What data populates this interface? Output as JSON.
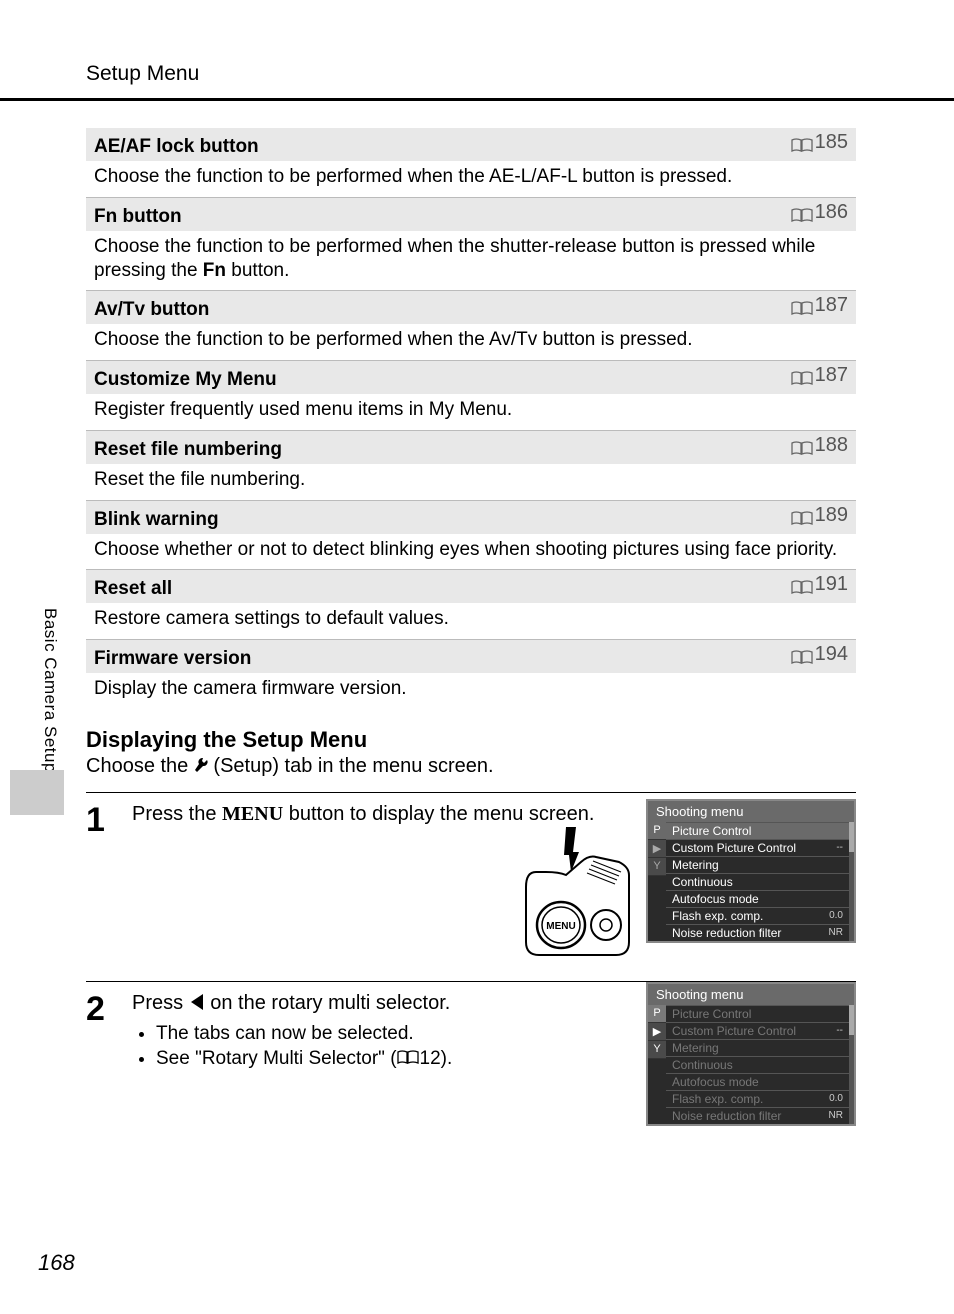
{
  "page": {
    "title": "Setup Menu",
    "sidebar_label": "Basic Camera Setup",
    "number": "168"
  },
  "items": [
    {
      "title": "AE/AF lock button",
      "page": "185",
      "desc": "Choose the function to be performed when the AE-L/AF-L button is pressed."
    },
    {
      "title": "Fn button",
      "page": "186",
      "desc_pre": "Choose the function to be performed when the shutter-release button is pressed while pressing the ",
      "desc_fn": "Fn",
      "desc_post": " button."
    },
    {
      "title": "Av/Tv button",
      "page": "187",
      "desc": "Choose the function to be performed when the Av/Tv button is pressed."
    },
    {
      "title": "Customize My Menu",
      "page": "187",
      "desc": "Register frequently used menu items in My Menu."
    },
    {
      "title": "Reset file numbering",
      "page": "188",
      "desc": "Reset the file numbering."
    },
    {
      "title": "Blink warning",
      "page": "189",
      "desc": "Choose whether or not to detect blinking eyes when shooting pictures using face priority."
    },
    {
      "title": "Reset all",
      "page": "191",
      "desc": "Restore camera settings to default values."
    },
    {
      "title": "Firmware version",
      "page": "194",
      "desc": "Display the camera firmware version."
    }
  ],
  "subsection": {
    "title": "Displaying the Setup Menu",
    "line_pre": "Choose the ",
    "line_post": " (Setup) tab in the menu screen."
  },
  "step1": {
    "num": "1",
    "text_pre": "Press the ",
    "menu_word": "MENU",
    "text_post": " button to display the menu screen."
  },
  "step2": {
    "num": "2",
    "text_pre": "Press ",
    "text_post": " on the rotary multi selector.",
    "bullet1": "The tabs can now be selected.",
    "bullet2_pre": "See \"Rotary Multi Selector\" (",
    "bullet2_page": "12",
    "bullet2_post": ")."
  },
  "lcd": {
    "header": "Shooting menu",
    "tabs": [
      "P",
      "▶",
      "Y"
    ],
    "rows": [
      {
        "label": "Picture Control",
        "val": ""
      },
      {
        "label": "Custom Picture Control",
        "val": "--"
      },
      {
        "label": "Metering",
        "val": ""
      },
      {
        "label": "Continuous",
        "val": ""
      },
      {
        "label": "Autofocus mode",
        "val": ""
      },
      {
        "label": "Flash exp. comp.",
        "val": "0.0"
      },
      {
        "label": "Noise reduction filter",
        "val": "NR"
      }
    ]
  }
}
